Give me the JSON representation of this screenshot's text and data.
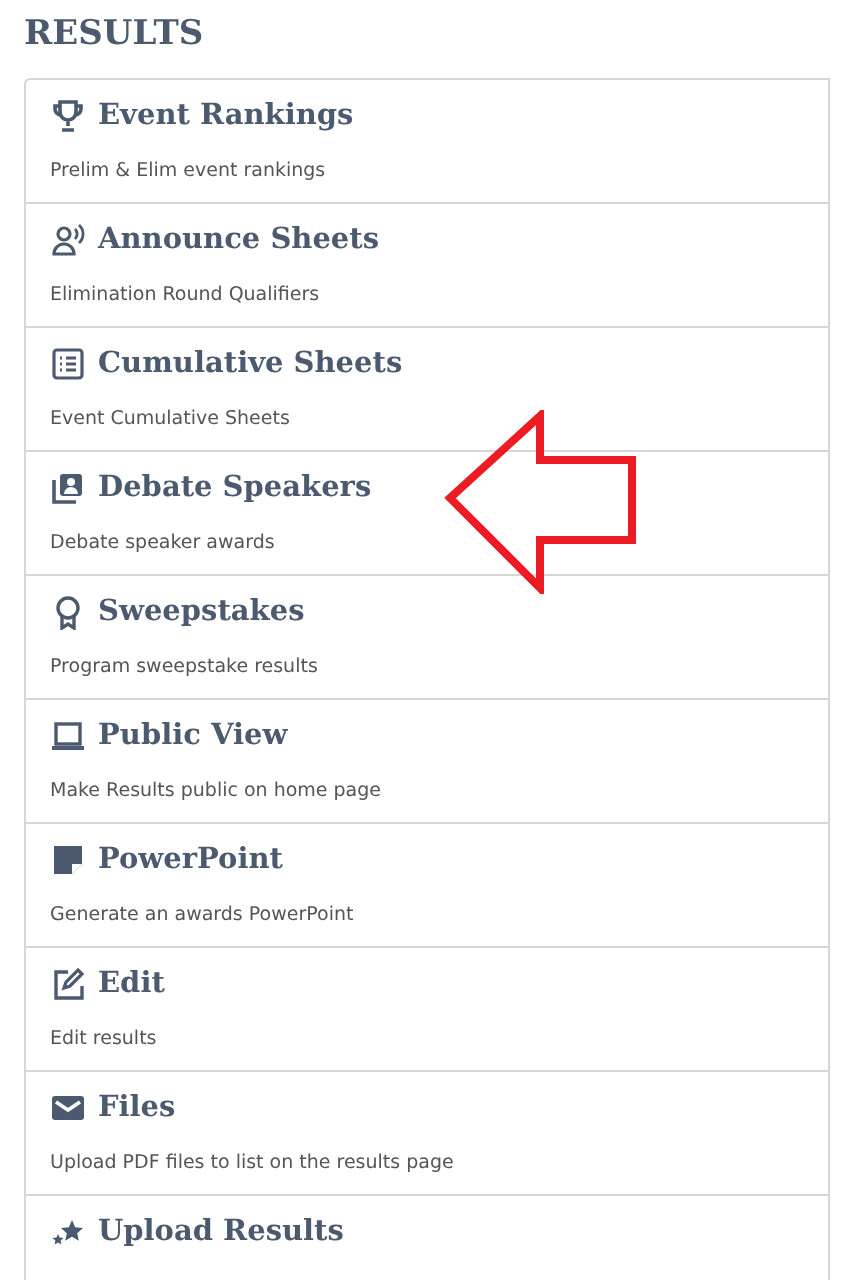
{
  "title": "RESULTS",
  "items": [
    {
      "label": "Event Rankings",
      "description": "Prelim & Elim event rankings"
    },
    {
      "label": "Announce Sheets",
      "description": "Elimination Round Qualifiers"
    },
    {
      "label": "Cumulative Sheets",
      "description": "Event Cumulative Sheets"
    },
    {
      "label": "Debate Speakers",
      "description": "Debate speaker awards"
    },
    {
      "label": "Sweepstakes",
      "description": "Program sweepstake results"
    },
    {
      "label": "Public View",
      "description": "Make Results public on home page"
    },
    {
      "label": "PowerPoint",
      "description": "Generate an awards PowerPoint"
    },
    {
      "label": "Edit",
      "description": "Edit results"
    },
    {
      "label": "Files",
      "description": "Upload PDF files to list on the results page"
    },
    {
      "label": "Upload Results"
    }
  ],
  "annotation": {
    "kind": "arrow",
    "color": "#ed1c24"
  }
}
